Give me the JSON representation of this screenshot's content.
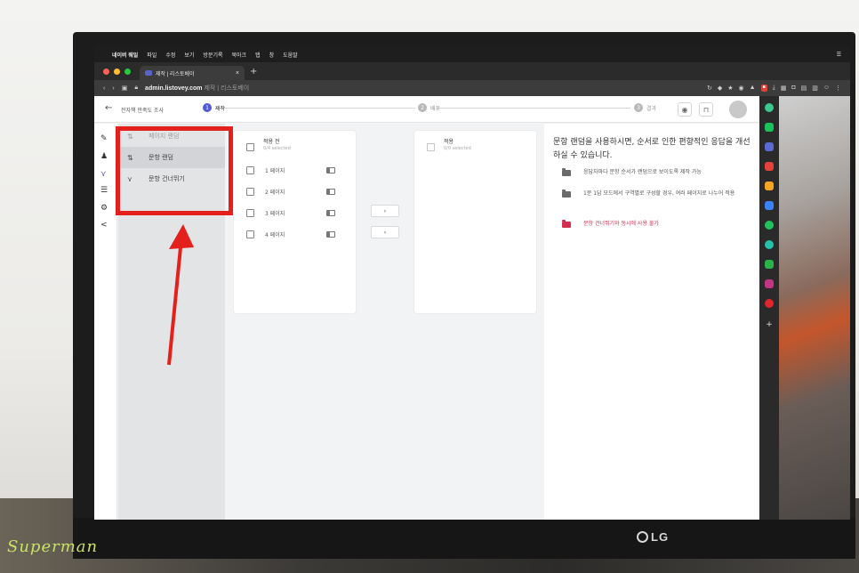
{
  "menubar": {
    "items": [
      "네이버 웨일",
      "파일",
      "수정",
      "보기",
      "방문기록",
      "북마크",
      "탭",
      "창",
      "도움말"
    ]
  },
  "browser": {
    "tab_title": "제작 | 리스토베이",
    "tab_close": "×",
    "new_tab": "+",
    "url_host": "admin.listovey.com",
    "url_rest": "제작 | 리스토베이"
  },
  "app": {
    "back_icon": "←",
    "survey_title": "전자책 만족도 조사",
    "steps": [
      {
        "num": "1",
        "label": "제작"
      },
      {
        "num": "2",
        "label": "배포"
      },
      {
        "num": "3",
        "label": "결과"
      }
    ],
    "header_icons": [
      "eye-icon",
      "lock-icon"
    ]
  },
  "leftnav": {
    "icons": [
      "pencil-icon",
      "stamp-icon",
      "branch-icon",
      "layout-icon",
      "gear-icon",
      "share-icon"
    ]
  },
  "menu": {
    "items": [
      {
        "icon": "⇅",
        "label": "페이지 랜덤",
        "state": "disabled"
      },
      {
        "icon": "⇅",
        "label": "문항 랜덤",
        "state": "selected"
      },
      {
        "icon": "⋎",
        "label": "문항 건너뛰기",
        "state": "normal"
      }
    ]
  },
  "left_card": {
    "title": "적용 전",
    "subtitle": "0/4 selected",
    "rows": [
      "1 페이지",
      "2 페이지",
      "3 페이지",
      "4 페이지"
    ]
  },
  "move_buttons": {
    "right": "›",
    "left": "‹"
  },
  "right_card": {
    "title": "적용",
    "subtitle": "0/0 selected"
  },
  "info": {
    "heading": "문항 랜덤을 사용하시면, 순서로 인한 편향적인 응답을 개선하실 수 있습니다.",
    "items": [
      {
        "text": "응답자마다 문항 순서가 랜덤으로 보이도록 제작 가능",
        "color": "#555555"
      },
      {
        "text": "1문 1답 모드에서 구역별로 구성할 경우, 여러 페이지로 나누어 적용",
        "color": "#555555"
      },
      {
        "text": "문항 건너뛰기와 동시에 사용 불가",
        "color": "#d3304f"
      }
    ]
  },
  "monitor": {
    "brand": "LG"
  },
  "watermark": {
    "text": "Superman"
  },
  "colors": {
    "accent": "#4f5bd5",
    "annotation": "#e4201d",
    "warning": "#d3304f"
  }
}
